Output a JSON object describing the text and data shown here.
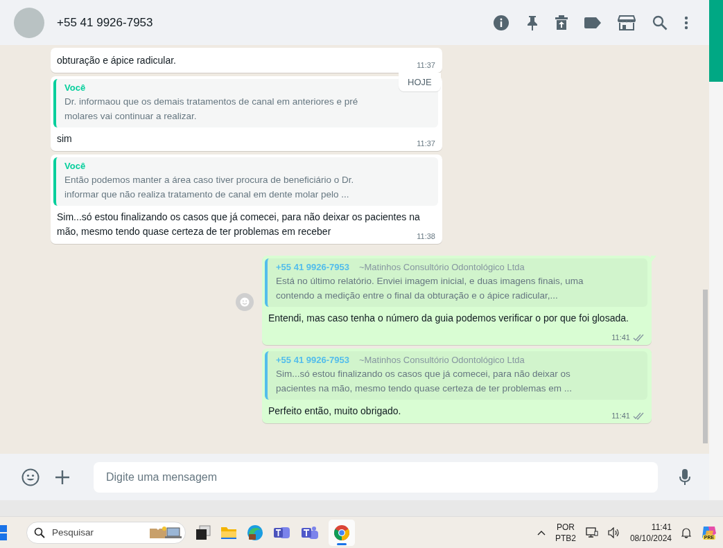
{
  "header": {
    "contact": "+55 41 9926-7953"
  },
  "date_chip": "HOJE",
  "messages": [
    {
      "kind": "in",
      "text": "obturação e ápice radicular.",
      "time": "11:37"
    },
    {
      "kind": "in",
      "quote": {
        "author": "Você",
        "text": "Dr. informaou que os demais tratamentos de canal em anteriores e pré molares vai continuar a realizar."
      },
      "text": "sim",
      "time": "11:37"
    },
    {
      "kind": "in",
      "quote": {
        "author": "Você",
        "text": "Então podemos manter a área caso tiver procura de beneficiário o Dr. informar que não realiza tratamento de canal em dente molar pelo ..."
      },
      "text": "Sim...só estou finalizando os casos que já comecei, para não deixar os pacientes na mão, mesmo tendo quase certeza de ter problemas em receber",
      "time": "11:38"
    },
    {
      "kind": "out",
      "quote": {
        "author": "+55 41 9926-7953",
        "author_note": "~Matinhos Consultório Odontológico Ltda",
        "text": "Está no último relatório. Enviei imagem inicial, e duas imagens finais, uma contendo a medição entre o final da obturação e o ápice radicular,..."
      },
      "text": "Entendi, mas caso tenha o número da guia podemos verificar o por que foi glosada.",
      "time": "11:41",
      "delivered": true
    },
    {
      "kind": "out",
      "quote": {
        "author": "+55 41 9926-7953",
        "author_note": "~Matinhos Consultório Odontológico Ltda",
        "text": "Sim...só estou finalizando os casos que já comecei, para não deixar os pacientes na mão, mesmo tendo quase certeza de ter problemas em ..."
      },
      "text": "Perfeito então, muito obrigado.",
      "time": "11:41",
      "delivered": true
    }
  ],
  "composer": {
    "placeholder": "Digite uma mensagem"
  },
  "taskbar": {
    "search_placeholder": "Pesquisar",
    "language": "POR",
    "layout": "PTB2",
    "time": "11:41",
    "date": "08/10/2024",
    "badge": "PRE"
  }
}
